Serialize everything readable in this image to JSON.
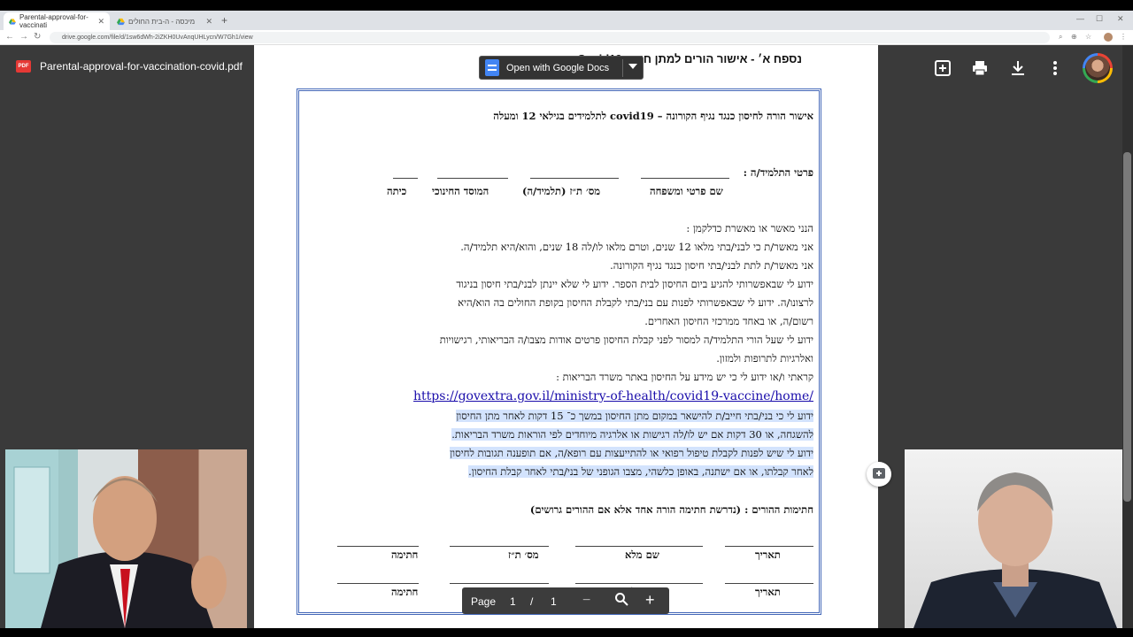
{
  "browser": {
    "tabs": [
      {
        "label": "Parental-approval-for-vaccinati"
      },
      {
        "label": "מיכסה - ה-בית החולים"
      }
    ],
    "url": "drive.google.com/file/d/1sw6dWh-2iZKH0UvAnqUHLycn/W7Gh1/view"
  },
  "drive": {
    "file_type_badge": "PDF",
    "file_title": "Parental-approval-for-vaccination-covid.pdf",
    "open_with_label": "Open with Google Docs"
  },
  "document": {
    "header": "נספח א׳ -  אישור הורים למתן חיסון Covid19",
    "title": "אישור הורה לחיסון כנגד נגיף הקורונה – covid19 לתלמידים בגילאי 12 ומעלה",
    "student_label": "פרטי התלמיד/ה :",
    "fields": [
      "שם פרטי ומשפחה",
      "מס׳ ת״ז (תלמיד/ה)",
      "המוסד החינוכי",
      "כיתה"
    ],
    "declaration_intro": "הנני מאשר או מאשרת כדלקמן :",
    "lines": [
      "אני מאשר/ת כי לבני/בתי מלאו 12 שנים, וטרם מלאו לו/לה 18 שנים, והוא/היא תלמיד/ה.",
      "אני מאשר/ת לתת לבני/בתי חיסון כנגד נגיף הקורונה.",
      "ידוע לי שבאפשרותי להגיע ביום החיסון לבית הספר. ידוע לי שלא יינתן לבני/בתי חיסון בניגוד",
      "לרצונו/ה. ידוע לי שבאפשרותי לפנות עם בני/בתי לקבלת החיסון בקופת החולים בה הוא/היא",
      "רשום/ה, או באחד ממרכזי החיסון האחרים.",
      "ידוע לי שעל הורי התלמיד/ה למסור לפני קבלת החיסון פרטים אודות מצבו/ה הבריאותי, רגישויות",
      "ואלרגיות לתרופות ולמזון.",
      "קראתי ו/או ידוע לי כי יש מידע על החיסון באתר משרד הבריאות :"
    ],
    "link": "https://govextra.gov.il/ministry-of-health/covid19-vaccine/home/",
    "highlighted_lines": [
      "ידוע לי כי בני/בתי חייב/ת להישאר במקום מתן החיסון במשך כ־ 15 דקות לאחר מתן החיסון",
      "להשגחה, או 30 דקות אם יש לו/לה רגישות או אלרגיה מיוחדים לפי הוראות משרד הבריאות.",
      "ידוע לי שיש לפנות לקבלת טיפול רפואי או להתייעצות עם רופא/ה, אם תופענה תגובות לחיסון",
      "לאחר קבלתו, או אם ישתנה, באופן כלשהי, מצבו הגופני של בני/בתי לאחר קבלת החיסון."
    ],
    "signatures_title": "חתימות ההורים : (נדרשת חתימה הורה אחד אלא אם ההורים גרושים)",
    "signature_fields": [
      "תאריך",
      "שם מלא",
      "מס׳ ת״ז",
      "חתימה"
    ]
  },
  "page_nav": {
    "page_label": "Page",
    "current": "1",
    "separator": "/",
    "total": "1"
  }
}
